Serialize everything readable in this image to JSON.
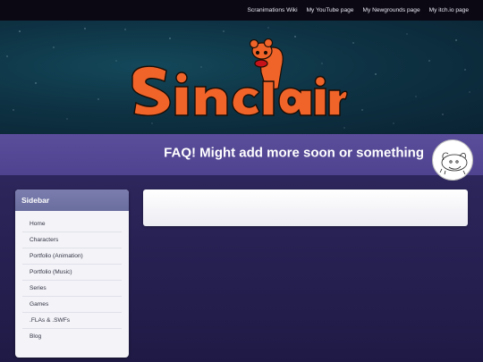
{
  "topnav": {
    "links": [
      {
        "label": "Scranimations Wiki"
      },
      {
        "label": "My YouTube page"
      },
      {
        "label": "My Newgrounds page"
      },
      {
        "label": "My itch.io page"
      }
    ]
  },
  "banner": {
    "logo_text": "Sinclair"
  },
  "page": {
    "title": "FAQ! Might add more soon or something"
  },
  "sidebar": {
    "title": "Sidebar",
    "items": [
      {
        "label": "Home"
      },
      {
        "label": "Characters"
      },
      {
        "label": "Portfolio (Animation)"
      },
      {
        "label": "Portfolio (Music)"
      },
      {
        "label": "Series"
      },
      {
        "label": "Games"
      },
      {
        "label": ".FLAs & .SWFs"
      },
      {
        "label": "Blog"
      }
    ]
  },
  "colors": {
    "nav_bg": "#0b0814",
    "title_strip": "#5a4d9a",
    "sidebar_header": "#7a7dad",
    "logo_orange": "#f0642a"
  }
}
